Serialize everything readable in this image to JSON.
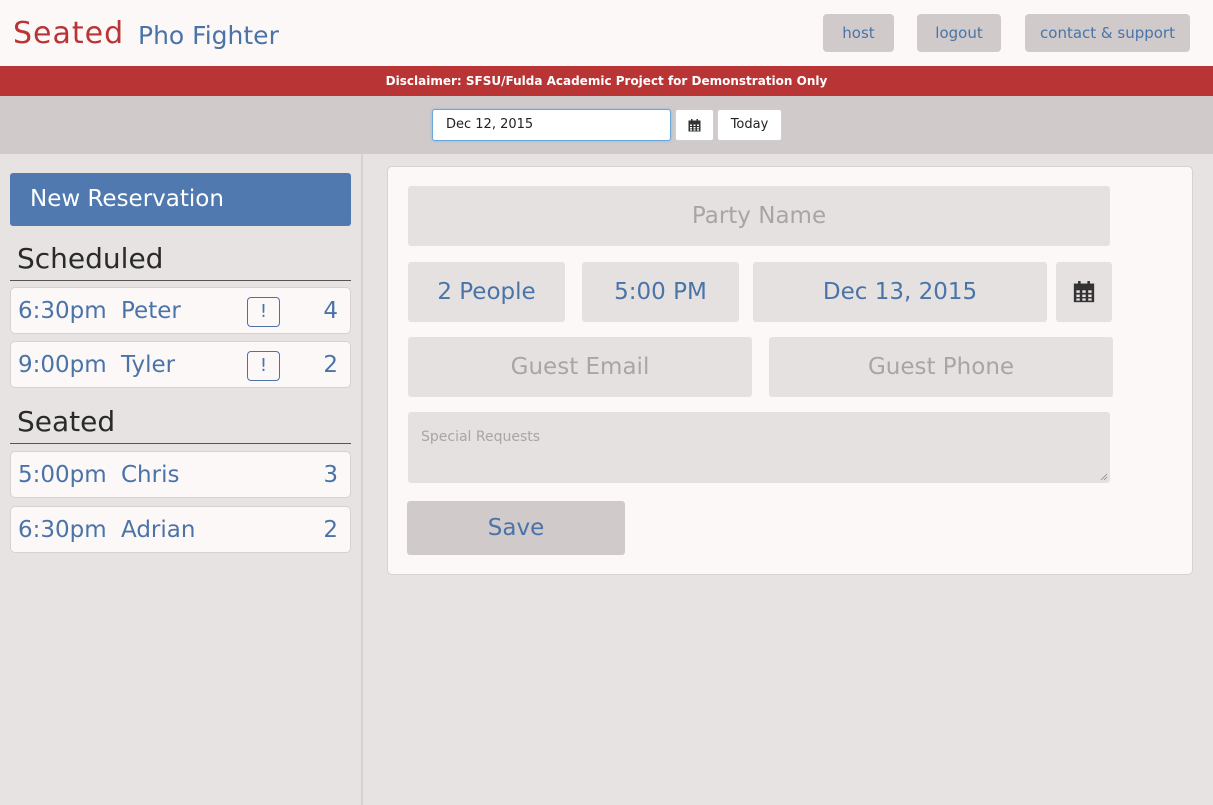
{
  "header": {
    "brand": "Seated",
    "restaurant": "Pho Fighter",
    "nav": {
      "host": "host",
      "logout": "logout",
      "contact": "contact & support"
    }
  },
  "disclaimer": "Disclaimer: SFSU/Fulda Academic Project for Demonstration Only",
  "date_bar": {
    "date_value": "Dec 12, 2015",
    "calendar_icon": "calendar-icon",
    "today_label": "Today"
  },
  "sidebar": {
    "new_reservation_label": "New Reservation",
    "scheduled_title": "Scheduled",
    "scheduled": [
      {
        "time": "6:30pm",
        "name": "Peter",
        "alert": "!",
        "count": "4"
      },
      {
        "time": "9:00pm",
        "name": "Tyler",
        "alert": "!",
        "count": "2"
      }
    ],
    "seated_title": "Seated",
    "seated": [
      {
        "time": "5:00pm",
        "name": "Chris",
        "count": "3"
      },
      {
        "time": "6:30pm",
        "name": "Adrian",
        "count": "2"
      }
    ]
  },
  "form": {
    "party_name_placeholder": "Party Name",
    "people_value": "2 People",
    "time_value": "5:00 PM",
    "date_value": "Dec 13, 2015",
    "guest_email_placeholder": "Guest Email",
    "guest_phone_placeholder": "Guest Phone",
    "special_requests_placeholder": "Special Requests",
    "save_label": "Save"
  },
  "colors": {
    "brand_red": "#b93535",
    "accent_blue": "#4a74a8",
    "button_blue": "#5079b0",
    "panel_gray": "#d0caca"
  }
}
